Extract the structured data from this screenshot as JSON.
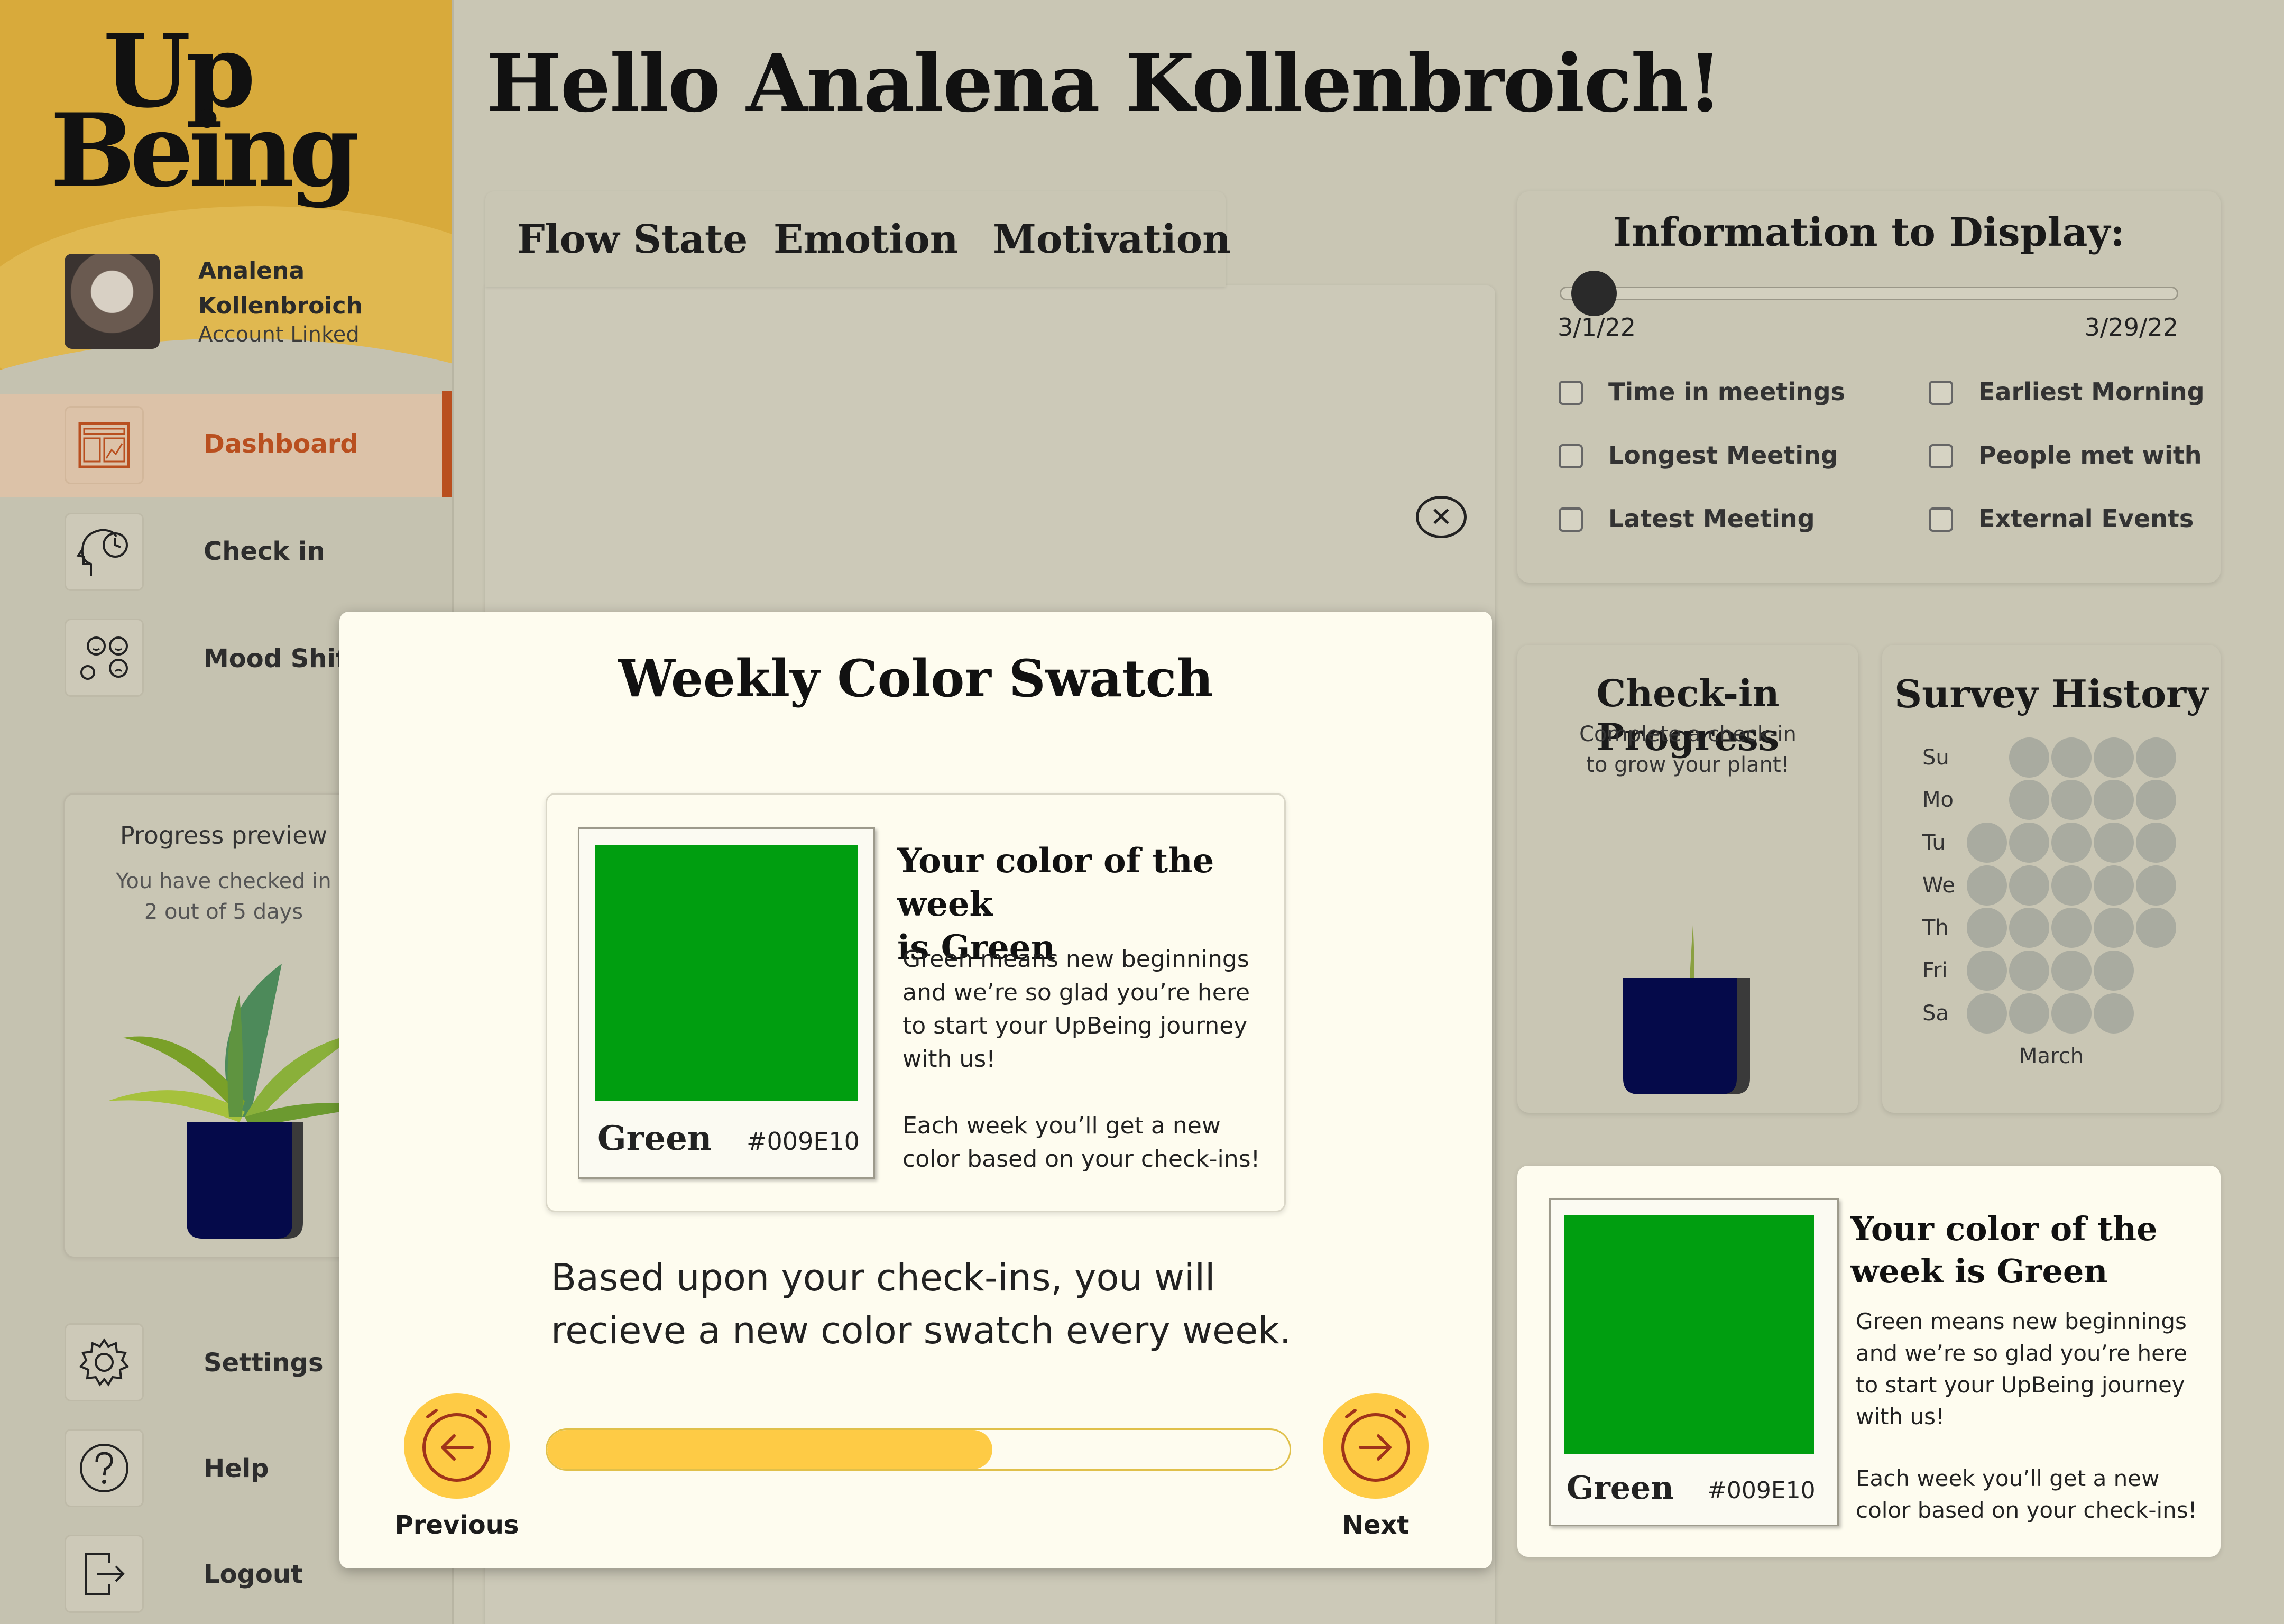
{
  "brand": {
    "logo_line1": "Up",
    "logo_line2": "Being"
  },
  "user": {
    "name": "Analena Kollenbroich",
    "status": "Account Linked"
  },
  "nav": {
    "dashboard": "Dashboard",
    "check_in": "Check in",
    "mood_shift": "Mood Shift",
    "settings": "Settings",
    "help": "Help",
    "logout": "Logout"
  },
  "progress_preview": {
    "title": "Progress preview",
    "text_line1": "You have checked in",
    "text_line2": "2 out of 5 days"
  },
  "header": {
    "greeting": "Hello Analena Kollenbroich!"
  },
  "tabs": [
    "Flow State",
    "Emotion",
    "Motivation"
  ],
  "info_display": {
    "title": "Information to Display:",
    "start_date": "3/1/22",
    "end_date": "3/29/22",
    "slider_value": 0.0,
    "options": [
      "Time in meetings",
      "Earliest Morning",
      "Longest Meeting",
      "People met with",
      "Latest Meeting",
      "External Events"
    ]
  },
  "checkin_progress": {
    "title": "Check-in Progress",
    "subtitle_line1": "Complete a check-in",
    "subtitle_line2": "to grow your plant!"
  },
  "survey_history": {
    "title": "Survey History",
    "days": [
      "Su",
      "Mo",
      "Tu",
      "We",
      "Th",
      "Fri",
      "Sa"
    ],
    "month": "March"
  },
  "color_of_week": {
    "title_line1": "Your color of the week",
    "title_line2": "is Green",
    "card_title_line1": "Your color of the",
    "card_title_line2": "week is Green",
    "description": [
      "Green means new beginnings",
      "and we’re so glad you’re here",
      "to start your UpBeing journey",
      "with us!"
    ],
    "note": [
      "Each week you’ll get a new",
      "color based on your check-ins!"
    ],
    "color_name": "Green",
    "color_hex": "#009E10"
  },
  "modal": {
    "title": "Weekly Color Swatch",
    "description_line1": "Based upon your check-ins, you will",
    "description_line2": "recieve a new color swatch every week.",
    "progress": 0.6,
    "previous_label": "Previous",
    "next_label": "Next"
  },
  "colors": {
    "sidebar_gold": "#d8aa3b",
    "accent_orange": "#b94f1f",
    "swatch_green": "#009e10",
    "button_yellow": "#fecb45",
    "plant_pot": "#050a4a"
  }
}
